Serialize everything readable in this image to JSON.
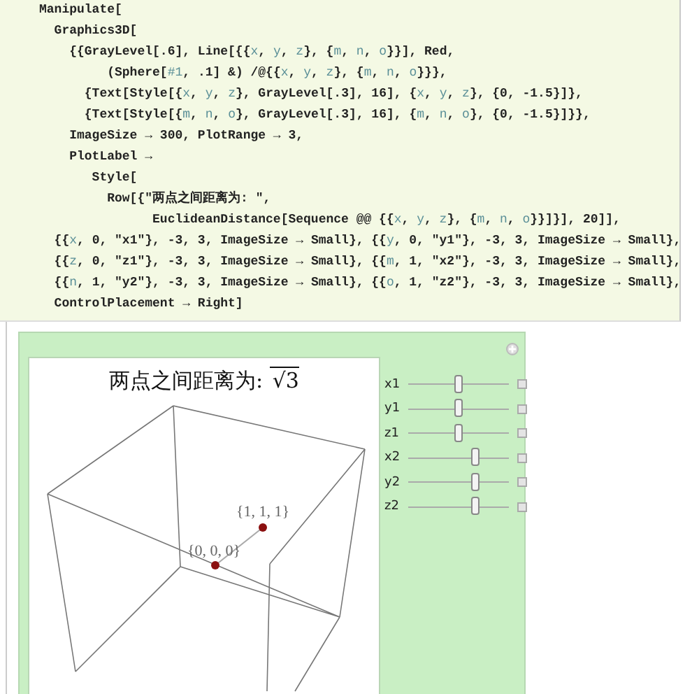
{
  "code_lines": [
    {
      "segments": [
        {
          "text": "Manipulate[",
          "kind": "plain"
        }
      ]
    },
    {
      "segments": [
        {
          "text": "  Graphics3D[",
          "kind": "plain"
        }
      ]
    },
    {
      "segments": [
        {
          "text": "    {{GrayLevel[.6], Line[{{",
          "kind": "plain"
        },
        {
          "text": "x",
          "kind": "var"
        },
        {
          "text": ", ",
          "kind": "plain"
        },
        {
          "text": "y",
          "kind": "var"
        },
        {
          "text": ", ",
          "kind": "plain"
        },
        {
          "text": "z",
          "kind": "var"
        },
        {
          "text": "}, {",
          "kind": "plain"
        },
        {
          "text": "m",
          "kind": "var"
        },
        {
          "text": ", ",
          "kind": "plain"
        },
        {
          "text": "n",
          "kind": "var"
        },
        {
          "text": ", ",
          "kind": "plain"
        },
        {
          "text": "o",
          "kind": "var"
        },
        {
          "text": "}}], Red,",
          "kind": "plain"
        }
      ]
    },
    {
      "segments": [
        {
          "text": "         (Sphere[",
          "kind": "plain"
        },
        {
          "text": "#1",
          "kind": "var"
        },
        {
          "text": ", .1] &) /@{{",
          "kind": "plain"
        },
        {
          "text": "x",
          "kind": "var"
        },
        {
          "text": ", ",
          "kind": "plain"
        },
        {
          "text": "y",
          "kind": "var"
        },
        {
          "text": ", ",
          "kind": "plain"
        },
        {
          "text": "z",
          "kind": "var"
        },
        {
          "text": "}, {",
          "kind": "plain"
        },
        {
          "text": "m",
          "kind": "var"
        },
        {
          "text": ", ",
          "kind": "plain"
        },
        {
          "text": "n",
          "kind": "var"
        },
        {
          "text": ", ",
          "kind": "plain"
        },
        {
          "text": "o",
          "kind": "var"
        },
        {
          "text": "}}},",
          "kind": "plain"
        }
      ]
    },
    {
      "segments": [
        {
          "text": "      {Text[Style[{",
          "kind": "plain"
        },
        {
          "text": "x",
          "kind": "var"
        },
        {
          "text": ", ",
          "kind": "plain"
        },
        {
          "text": "y",
          "kind": "var"
        },
        {
          "text": ", ",
          "kind": "plain"
        },
        {
          "text": "z",
          "kind": "var"
        },
        {
          "text": "}, GrayLevel[.3], 16], {",
          "kind": "plain"
        },
        {
          "text": "x",
          "kind": "var"
        },
        {
          "text": ", ",
          "kind": "plain"
        },
        {
          "text": "y",
          "kind": "var"
        },
        {
          "text": ", ",
          "kind": "plain"
        },
        {
          "text": "z",
          "kind": "var"
        },
        {
          "text": "}, {0, -1.5}]},",
          "kind": "plain"
        }
      ]
    },
    {
      "segments": [
        {
          "text": "      {Text[Style[{",
          "kind": "plain"
        },
        {
          "text": "m",
          "kind": "var"
        },
        {
          "text": ", ",
          "kind": "plain"
        },
        {
          "text": "n",
          "kind": "var"
        },
        {
          "text": ", ",
          "kind": "plain"
        },
        {
          "text": "o",
          "kind": "var"
        },
        {
          "text": "}, GrayLevel[.3], 16], {",
          "kind": "plain"
        },
        {
          "text": "m",
          "kind": "var"
        },
        {
          "text": ", ",
          "kind": "plain"
        },
        {
          "text": "n",
          "kind": "var"
        },
        {
          "text": ", ",
          "kind": "plain"
        },
        {
          "text": "o",
          "kind": "var"
        },
        {
          "text": "}, {0, -1.5}]}},",
          "kind": "plain"
        }
      ]
    },
    {
      "segments": [
        {
          "text": "    ImageSize → 300, PlotRange → 3,",
          "kind": "plain"
        }
      ]
    },
    {
      "segments": [
        {
          "text": "    PlotLabel →",
          "kind": "plain"
        }
      ]
    },
    {
      "segments": [
        {
          "text": "       Style[",
          "kind": "plain"
        }
      ]
    },
    {
      "segments": [
        {
          "text": "         Row[{\"两点之间距离为: \",",
          "kind": "plain"
        }
      ]
    },
    {
      "segments": [
        {
          "text": "               EuclideanDistance[Sequence @@ {{",
          "kind": "plain"
        },
        {
          "text": "x",
          "kind": "var"
        },
        {
          "text": ", ",
          "kind": "plain"
        },
        {
          "text": "y",
          "kind": "var"
        },
        {
          "text": ", ",
          "kind": "plain"
        },
        {
          "text": "z",
          "kind": "var"
        },
        {
          "text": "}, {",
          "kind": "plain"
        },
        {
          "text": "m",
          "kind": "var"
        },
        {
          "text": ", ",
          "kind": "plain"
        },
        {
          "text": "n",
          "kind": "var"
        },
        {
          "text": ", ",
          "kind": "plain"
        },
        {
          "text": "o",
          "kind": "var"
        },
        {
          "text": "}}]}], 20]],",
          "kind": "plain"
        }
      ]
    },
    {
      "segments": [
        {
          "text": "  {{",
          "kind": "plain"
        },
        {
          "text": "x",
          "kind": "var"
        },
        {
          "text": ", 0, \"x1\"}, -3, 3, ImageSize → Small}, {{",
          "kind": "plain"
        },
        {
          "text": "y",
          "kind": "var"
        },
        {
          "text": ", 0, \"y1\"}, -3, 3, ImageSize → Small},",
          "kind": "plain"
        }
      ]
    },
    {
      "segments": [
        {
          "text": "  {{",
          "kind": "plain"
        },
        {
          "text": "z",
          "kind": "var"
        },
        {
          "text": ", 0, \"z1\"}, -3, 3, ImageSize → Small}, {{",
          "kind": "plain"
        },
        {
          "text": "m",
          "kind": "var"
        },
        {
          "text": ", 1, \"x2\"}, -3, 3, ImageSize → Small},",
          "kind": "plain"
        }
      ]
    },
    {
      "segments": [
        {
          "text": "  {{",
          "kind": "plain"
        },
        {
          "text": "n",
          "kind": "var"
        },
        {
          "text": ", 1, \"y2\"}, -3, 3, ImageSize → Small}, {{",
          "kind": "plain"
        },
        {
          "text": "o",
          "kind": "var"
        },
        {
          "text": ", 1, \"z2\"}, -3, 3, ImageSize → Small},",
          "kind": "plain"
        }
      ]
    },
    {
      "segments": [
        {
          "text": "  ControlPlacement → Right]",
          "kind": "plain"
        }
      ]
    }
  ],
  "output": {
    "plot": {
      "title": "两点之间距离为: ",
      "title_root": "√3",
      "points": [
        {
          "label": "{0, 0, 0}"
        },
        {
          "label": "{1, 1, 1}"
        }
      ]
    },
    "sliders": [
      {
        "label": "x1",
        "level": 0.5
      },
      {
        "label": "y1",
        "level": 0.5
      },
      {
        "label": "z1",
        "level": 0.5
      },
      {
        "label": "x2",
        "level": 0.667
      },
      {
        "label": "y2",
        "level": 0.667
      },
      {
        "label": "z2",
        "level": 0.667
      }
    ]
  }
}
